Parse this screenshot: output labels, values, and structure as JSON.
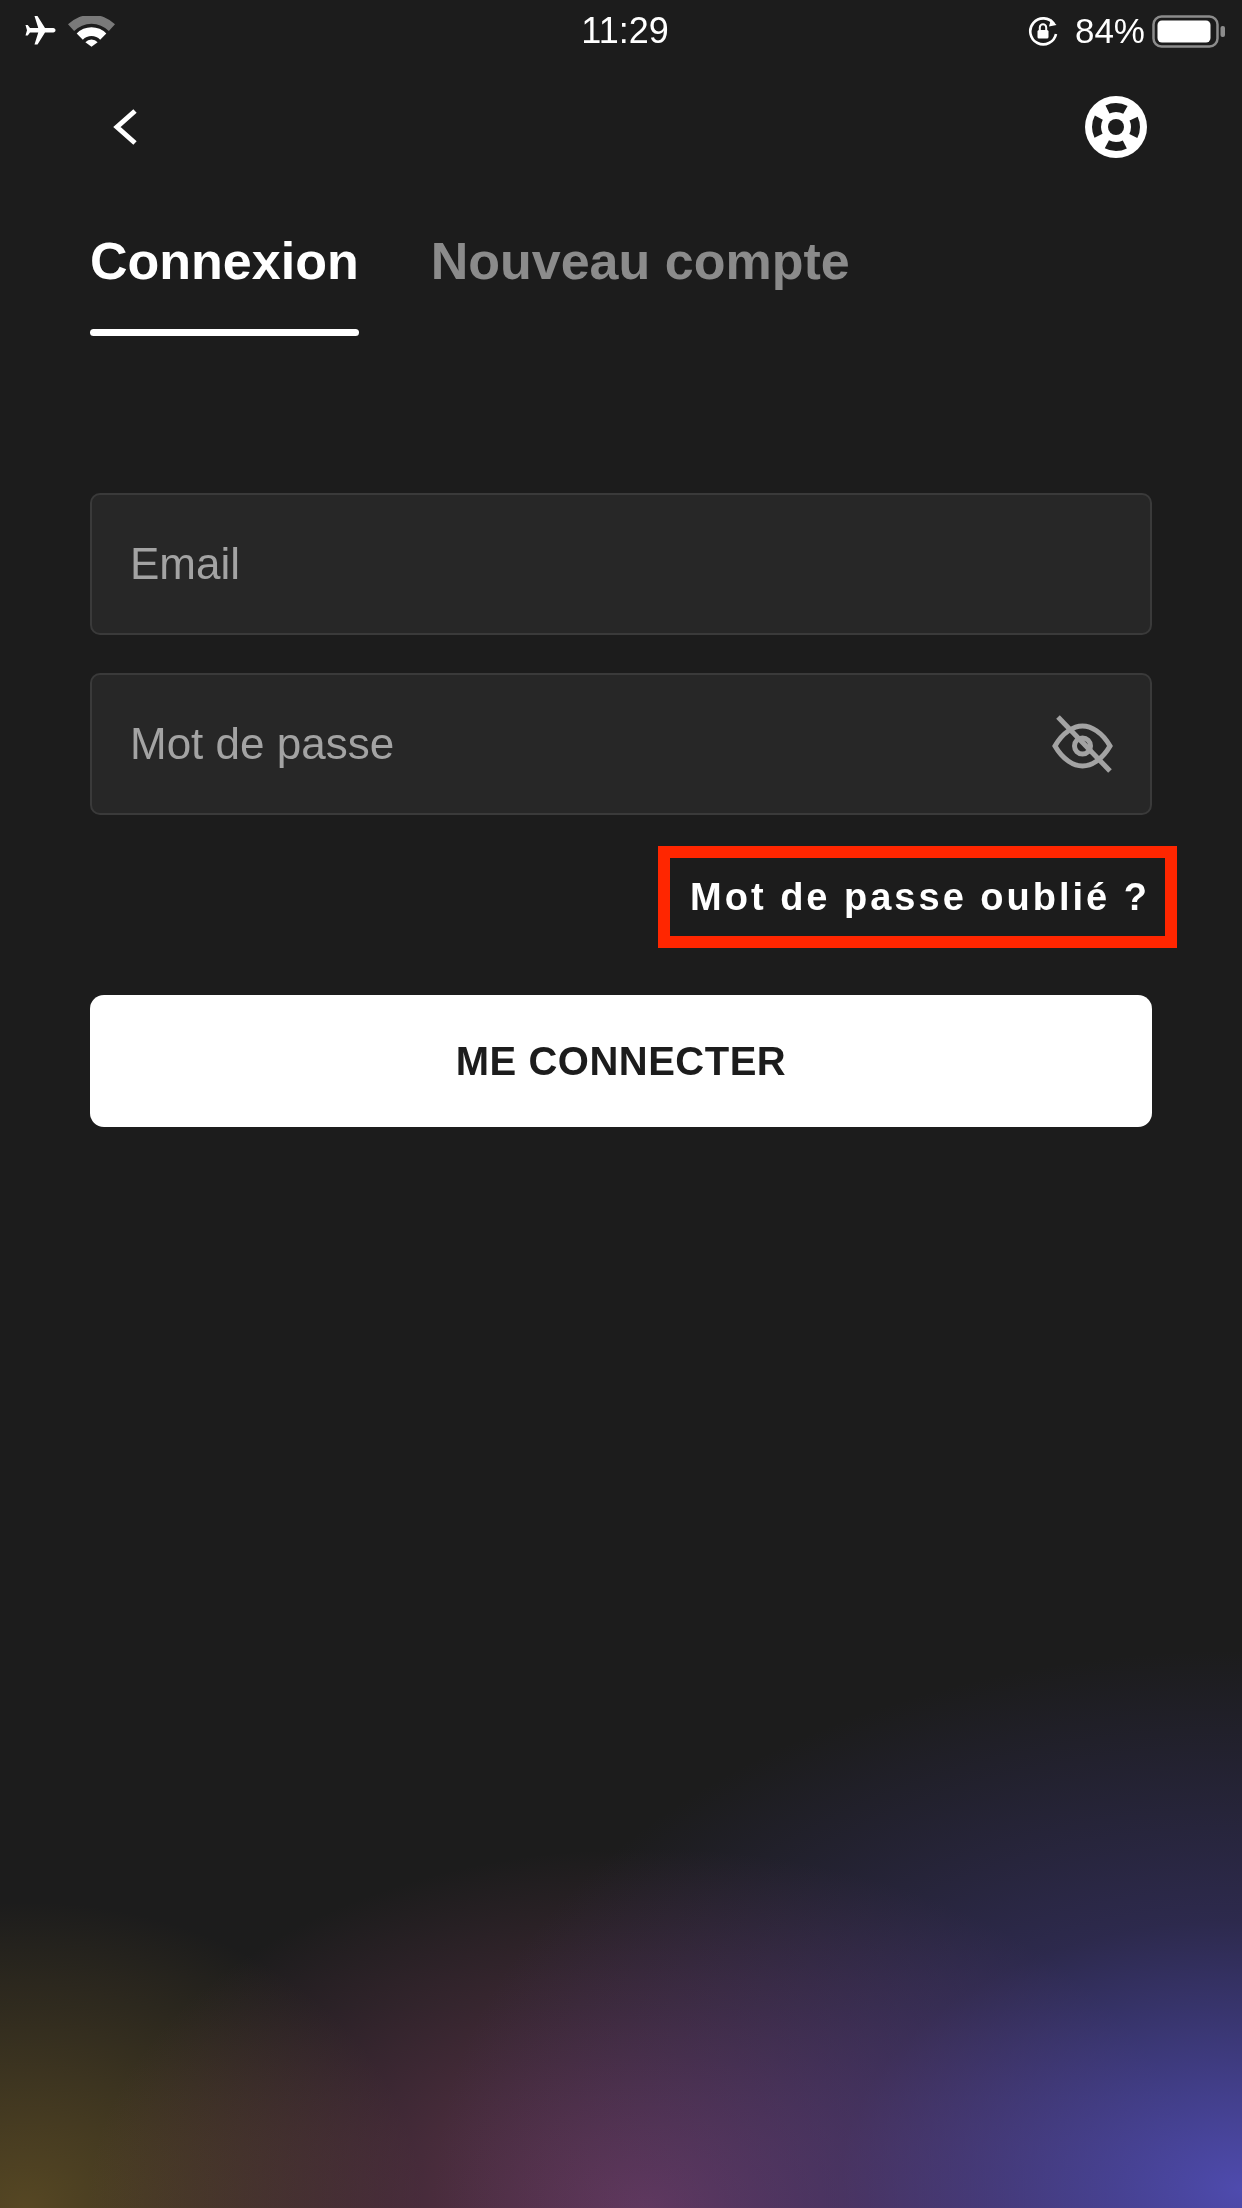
{
  "status_bar": {
    "time": "11:29",
    "battery": "84%"
  },
  "tabs": [
    {
      "label": "Connexion",
      "selected": true
    },
    {
      "label": "Nouveau compte",
      "selected": false
    }
  ],
  "fields": [
    {
      "kind": "email",
      "placeholder": "Email"
    },
    {
      "kind": "password",
      "placeholder": "Mot de passe",
      "masked": true
    }
  ],
  "forgot_password": {
    "label": "Mot de passe oublié ?",
    "highlighted": true
  },
  "submit_button": {
    "label": "ME CONNECTER"
  }
}
